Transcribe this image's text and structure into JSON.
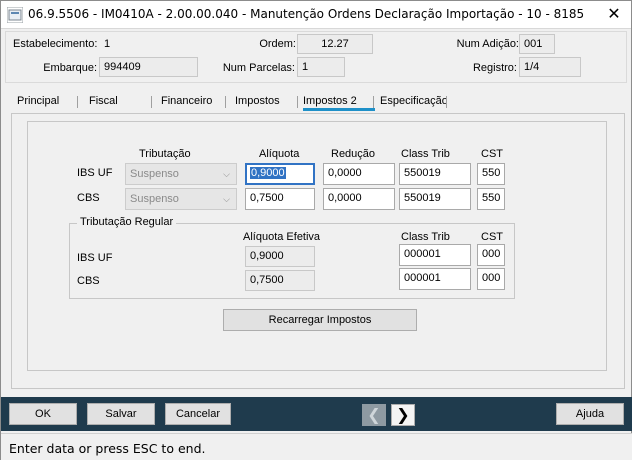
{
  "window": {
    "title": "06.9.5506 - IM0410A - 2.00.00.040 - Manutenção Ordens Declaração Importação - 10 - 8185",
    "close_glyph": "✕"
  },
  "header": {
    "estabelecimento": {
      "label": "Estabelecimento:",
      "value": "1"
    },
    "ordem": {
      "label": "Ordem:",
      "value": "12.27"
    },
    "num_adicao": {
      "label": "Num Adição:",
      "value": "001"
    },
    "embarque": {
      "label": "Embarque:",
      "value": "994409"
    },
    "num_parcelas": {
      "label": "Num Parcelas:",
      "value": "1"
    },
    "registro": {
      "label": "Registro:",
      "value": "1/4"
    }
  },
  "tabs": [
    {
      "label": "Principal"
    },
    {
      "label": "Fiscal"
    },
    {
      "label": "Financeiro"
    },
    {
      "label": "Impostos"
    },
    {
      "label": "Impostos 2"
    },
    {
      "label": "Especificação"
    }
  ],
  "active_tab": "Impostos 2",
  "columns": {
    "tributacao": "Tributação",
    "aliquota": "Alíquota",
    "reducao": "Redução",
    "class_trib": "Class Trib",
    "cst": "CST"
  },
  "rows": [
    {
      "label": "IBS UF",
      "tributacao": "Suspenso",
      "aliquota": "0,9000",
      "reducao": "0,0000",
      "class_trib": "550019",
      "cst": "550"
    },
    {
      "label": "CBS",
      "tributacao": "Suspenso",
      "aliquota": "0,7500",
      "reducao": "0,0000",
      "class_trib": "550019",
      "cst": "550"
    }
  ],
  "regular": {
    "title": "Tributação Regular",
    "col_aliquota_efetiva": "Alíquota Efetiva",
    "col_class_trib": "Class Trib",
    "col_cst": "CST",
    "rows": [
      {
        "label": "IBS UF",
        "aliquota_efetiva": "0,9000",
        "class_trib": "000001",
        "cst": "000"
      },
      {
        "label": "CBS",
        "aliquota_efetiva": "0,7500",
        "class_trib": "000001",
        "cst": "000"
      }
    ]
  },
  "reload_button": "Recarregar Impostos",
  "buttons": {
    "ok": "OK",
    "salvar": "Salvar",
    "cancelar": "Cancelar",
    "ajuda": "Ajuda",
    "prev": "❮",
    "next": "❯"
  },
  "status": "Enter data or press ESC to end.",
  "colors": {
    "button_bar": "#1f3b4d",
    "tab_underline": "#1e90c8",
    "focus": "#3173c4"
  }
}
